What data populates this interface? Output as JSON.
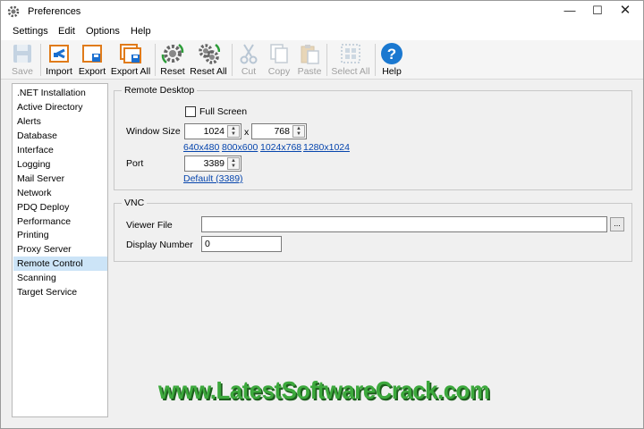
{
  "window": {
    "title": "Preferences"
  },
  "menubar": {
    "items": [
      "Settings",
      "Edit",
      "Options",
      "Help"
    ]
  },
  "toolbar": {
    "save": "Save",
    "import": "Import",
    "export": "Export",
    "export_all": "Export All",
    "reset": "Reset",
    "reset_all": "Reset All",
    "cut": "Cut",
    "copy": "Copy",
    "paste": "Paste",
    "select_all": "Select All",
    "help": "Help"
  },
  "sidebar": {
    "items": [
      ".NET Installation",
      "Active Directory",
      "Alerts",
      "Database",
      "Interface",
      "Logging",
      "Mail Server",
      "Network",
      "PDQ Deploy",
      "Performance",
      "Printing",
      "Proxy Server",
      "Remote Control",
      "Scanning",
      "Target Service"
    ],
    "selected": "Remote Control"
  },
  "remote_desktop": {
    "group_title": "Remote Desktop",
    "full_screen_label": "Full Screen",
    "full_screen_checked": false,
    "window_size_label": "Window Size",
    "width": "1024",
    "separator": "x",
    "height": "768",
    "presets": [
      "640x480",
      "800x600",
      "1024x768",
      "1280x1024"
    ],
    "port_label": "Port",
    "port": "3389",
    "default_link": "Default (3389)"
  },
  "vnc": {
    "group_title": "VNC",
    "viewer_file_label": "Viewer File",
    "viewer_file": "",
    "browse": "...",
    "display_number_label": "Display Number",
    "display_number": "0"
  },
  "watermark": "www.LatestSoftwareCrack.com"
}
